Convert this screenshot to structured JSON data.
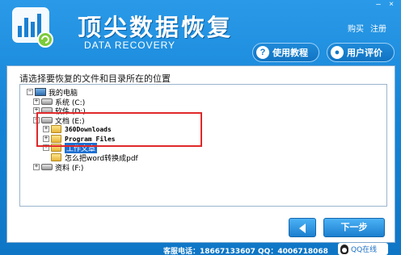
{
  "window": {
    "minimize": "–",
    "close": "×"
  },
  "brand": {
    "title_cn": "顶尖数据恢复",
    "title_en": "DATA RECOVERY"
  },
  "top_links": {
    "buy": "购买",
    "register": "注册"
  },
  "buttons": {
    "guide": "使用教程",
    "review": "用户评价",
    "guide_icon": "help-icon",
    "review_icon": "user-icon",
    "next": "下一步",
    "back_icon": "arrow-left-icon"
  },
  "panel": {
    "instruction": "请选择要恢复的文件和目录所在的位置"
  },
  "tree": [
    {
      "label": "我的电脑",
      "icon": "computer-icon",
      "expander": "−"
    },
    {
      "label": "系统 (C:)",
      "icon": "drive-icon",
      "expander": "+"
    },
    {
      "label": "软件 (D:)",
      "icon": "drive-icon",
      "expander": "+"
    },
    {
      "label": "文档 (E:)",
      "icon": "drive-icon",
      "expander": "−"
    },
    {
      "label": "360Downloads",
      "icon": "folder-icon",
      "expander": "+"
    },
    {
      "label": "Program Files",
      "icon": "folder-icon",
      "expander": "+"
    },
    {
      "label": "工作文章",
      "icon": "folder-icon",
      "expander": "+",
      "selected": true
    },
    {
      "label": "怎么把word转换成pdf",
      "icon": "folder-icon",
      "expander": ""
    },
    {
      "label": "资料 (F:)",
      "icon": "drive-icon",
      "expander": "+"
    }
  ],
  "footer": {
    "contact": "客服电话：18667133607  QQ：4006718068",
    "qq_label": "QQ在线"
  },
  "colors": {
    "accent": "#1584d6",
    "selection": "#1e6fd0",
    "highlight_box": "#e0282a"
  }
}
